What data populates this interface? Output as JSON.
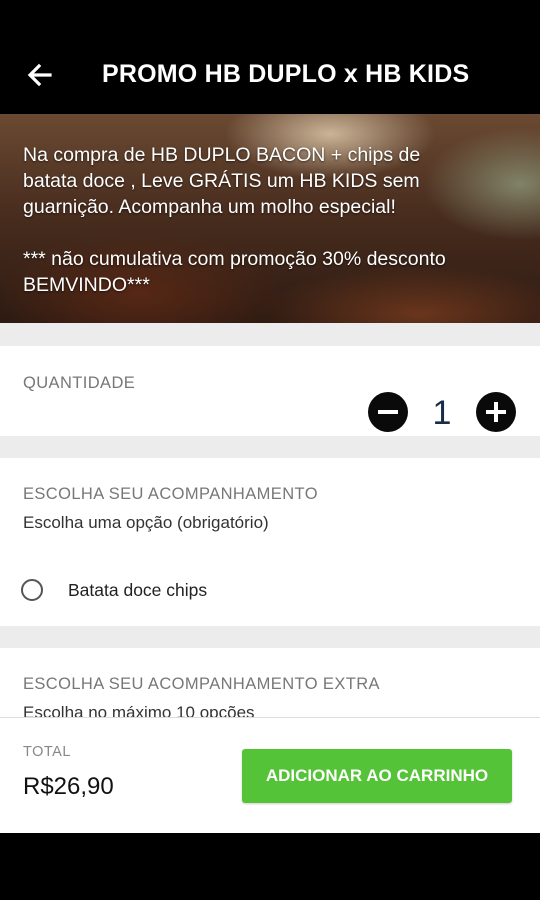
{
  "header": {
    "title": "PROMO HB DUPLO x HB KIDS",
    "back_icon": "arrow-left-icon"
  },
  "banner": {
    "line1": "Na compra de HB DUPLO BACON   + chips de",
    "line2": "batata doce , Leve GRÁTIS um HB KIDS sem",
    "line3": "guarnição.  Acompanha um molho especial!",
    "line4": "*** não cumulativa com promoção 30% desconto",
    "line5": "BEMVINDO***"
  },
  "quantity": {
    "label": "QUANTIDADE",
    "value": "1",
    "minus_icon": "minus-circle-icon",
    "plus_icon": "plus-circle-icon"
  },
  "acompanhamento": {
    "title": "ESCOLHA SEU ACOMPANHAMENTO",
    "subtitle": "Escolha uma opção (obrigatório)",
    "options": [
      {
        "label": "Batata doce chips",
        "selected": false
      }
    ]
  },
  "acompanhamento_extra": {
    "title": "ESCOLHA SEU ACOMPANHAMENTO EXTRA",
    "subtitle": "Escolha no máximo 10 opções"
  },
  "footer": {
    "total_label": "TOTAL",
    "total_value": "R$26,90",
    "add_button": "ADICIONAR AO CARRINHO"
  },
  "colors": {
    "accent_green": "#55c338",
    "header_bg": "#000000",
    "section_bg": "#ececec"
  }
}
